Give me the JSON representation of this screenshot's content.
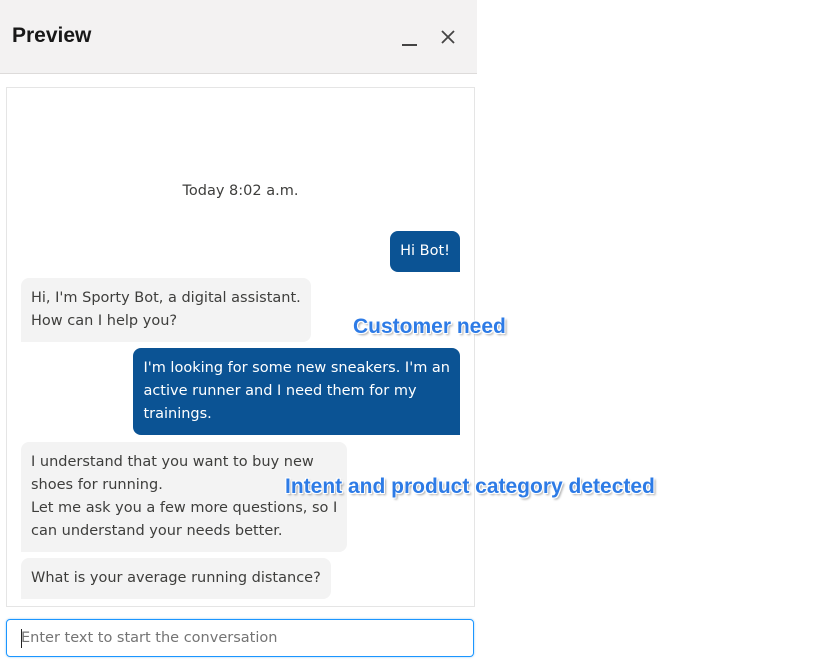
{
  "header": {
    "title": "Preview"
  },
  "icons": {
    "minimize": "minimize-icon",
    "close": "close-icon"
  },
  "chat": {
    "timestamp": "Today 8:02 a.m.",
    "messages": [
      {
        "sender": "user",
        "lines": [
          "Hi Bot!"
        ]
      },
      {
        "sender": "bot",
        "lines": [
          "Hi, I'm Sporty Bot, a digital assistant.",
          "How can I help you?"
        ]
      },
      {
        "sender": "user",
        "lines": [
          "I'm looking for some new sneakers. I'm an",
          "active runner and I need them for my",
          "trainings."
        ]
      },
      {
        "sender": "bot",
        "lines": [
          "I understand that you want to buy new",
          "shoes for running.",
          "Let me ask you a few more questions, so I",
          "can understand your needs better."
        ]
      },
      {
        "sender": "bot",
        "lines": [
          "What is your average running distance?"
        ]
      }
    ]
  },
  "input": {
    "placeholder": "Enter text to start the conversation",
    "value": ""
  },
  "annotations": {
    "customer_need": "Customer need",
    "intent_detected": "Intent and product category detected"
  },
  "colors": {
    "user_bubble": "#0b5394",
    "bot_bubble": "#f3f3f3",
    "annotation": "#2d7be6",
    "input_focus": "#1b96ff"
  }
}
